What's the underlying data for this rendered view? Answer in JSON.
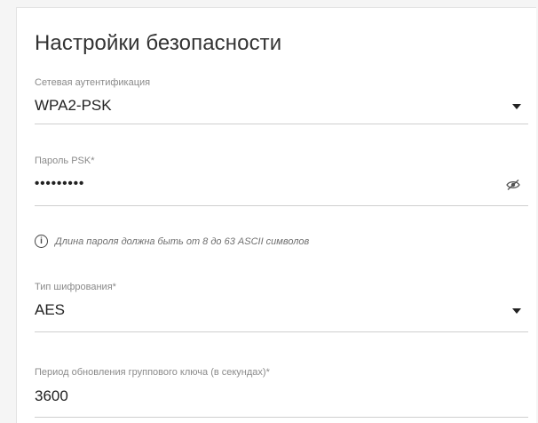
{
  "section": {
    "title": "Настройки безопасности"
  },
  "fields": {
    "auth": {
      "label": "Сетевая аутентификация",
      "value": "WPA2-PSK",
      "icon": "chevron-down-icon"
    },
    "psk": {
      "label": "Пароль PSK*",
      "value": "•••••••••",
      "icon": "eye-off-icon"
    },
    "hint": {
      "text": "Длина пароля должна быть от 8 до 63 ASCII символов",
      "icon": "info-icon"
    },
    "cipher": {
      "label": "Тип шифрования*",
      "value": "AES",
      "icon": "chevron-down-icon"
    },
    "group_key": {
      "label": "Период обновления группового ключа (в секундах)*",
      "value": "3600"
    }
  }
}
